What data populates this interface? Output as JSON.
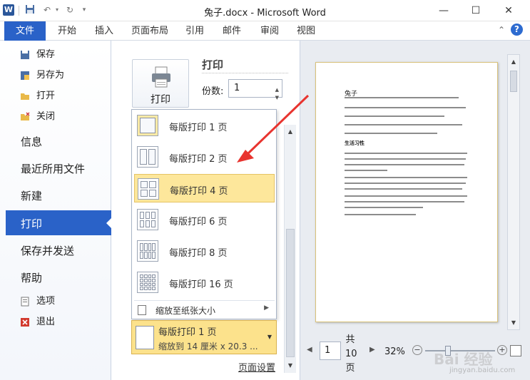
{
  "window": {
    "app_icon": "W",
    "title": "兔子.docx - Microsoft Word",
    "minimize": "—",
    "maximize": "☐",
    "close": "✕",
    "quick_access": [
      "save-icon",
      "undo-icon",
      "redo-icon",
      "customize-icon"
    ]
  },
  "ribbon": {
    "file_tab": "文件",
    "tabs": [
      "开始",
      "插入",
      "页面布局",
      "引用",
      "邮件",
      "审阅",
      "视图"
    ],
    "help": "?"
  },
  "nav": {
    "small_items": [
      {
        "label": "保存",
        "icon": "save-icon"
      },
      {
        "label": "另存为",
        "icon": "save-as-icon"
      },
      {
        "label": "打开",
        "icon": "folder-open-icon"
      },
      {
        "label": "关闭",
        "icon": "folder-close-icon"
      }
    ],
    "big_items": [
      "信息",
      "最近所用文件",
      "新建"
    ],
    "active": "打印",
    "more_items": [
      "保存并发送",
      "帮助"
    ],
    "bottom_items": [
      {
        "label": "选项",
        "icon": "options-icon"
      },
      {
        "label": "退出",
        "icon": "exit-icon"
      }
    ]
  },
  "print": {
    "title": "打印",
    "button_label": "打印",
    "copies_label": "份数:",
    "copies_value": "1"
  },
  "pages_per_sheet": {
    "options": [
      "每版打印 1 页",
      "每版打印 2 页",
      "每版打印 4 页",
      "每版打印 6 页",
      "每版打印 8 页",
      "每版打印 16 页"
    ],
    "highlighted": "每版打印 4 页",
    "fit_label": "缩放至纸张大小",
    "selected_line1": "每版打印 1 页",
    "selected_line2": "缩放到 14 厘米 x 20.3 ...",
    "page_setup": "页面设置"
  },
  "preview": {
    "doc_title": "兔子",
    "subheading": "生活习性",
    "page_current": "1",
    "page_total": "共 10 页",
    "zoom": "32%",
    "zoom_minus": "−",
    "zoom_plus": "+"
  },
  "watermark": {
    "text": "Bai 经验",
    "sub": "jingyan.baidu.com"
  },
  "colors": {
    "accent": "#2a62c8",
    "highlight": "#fde79b",
    "arrow": "#e8342f"
  }
}
